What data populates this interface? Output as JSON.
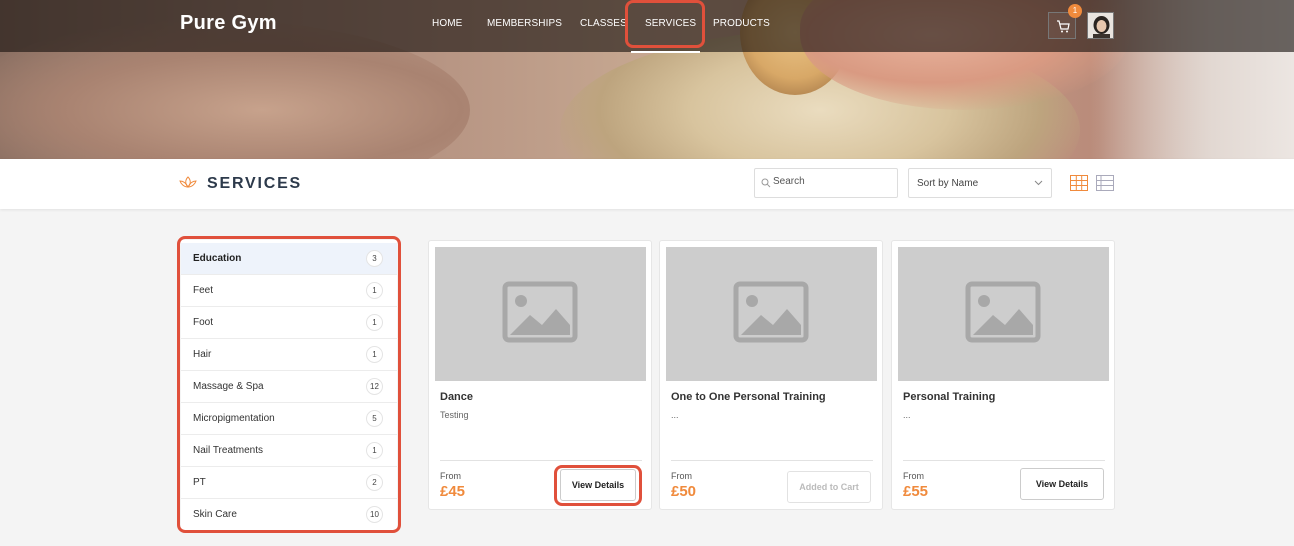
{
  "brand": "Pure Gym",
  "nav": {
    "items": [
      "HOME",
      "MEMBERSHIPS",
      "CLASSES",
      "SERVICES",
      "PRODUCTS"
    ],
    "active": "SERVICES"
  },
  "cart": {
    "count": "1"
  },
  "services_bar": {
    "title": "SERVICES",
    "search_placeholder": "Search",
    "sort_value": "Sort by Name"
  },
  "categories": [
    {
      "label": "Education",
      "count": "3"
    },
    {
      "label": "Feet",
      "count": "1"
    },
    {
      "label": "Foot",
      "count": "1"
    },
    {
      "label": "Hair",
      "count": "1"
    },
    {
      "label": "Massage & Spa",
      "count": "12"
    },
    {
      "label": "Micropigmentation",
      "count": "5"
    },
    {
      "label": "Nail Treatments",
      "count": "1"
    },
    {
      "label": "PT",
      "count": "2"
    },
    {
      "label": "Skin Care",
      "count": "10"
    }
  ],
  "products": [
    {
      "name": "Dance",
      "desc": "Testing",
      "from": "From",
      "price": "£45",
      "button": "View Details"
    },
    {
      "name": "One to One Personal Training",
      "desc": "...",
      "from": "From",
      "price": "£50",
      "button": "Added to Cart"
    },
    {
      "name": "Personal Training",
      "desc": "...",
      "from": "From",
      "price": "£55",
      "button": "View Details"
    }
  ],
  "colors": {
    "accent": "#f08a3c",
    "highlight": "#e0503b",
    "title": "#2d3a4b"
  }
}
